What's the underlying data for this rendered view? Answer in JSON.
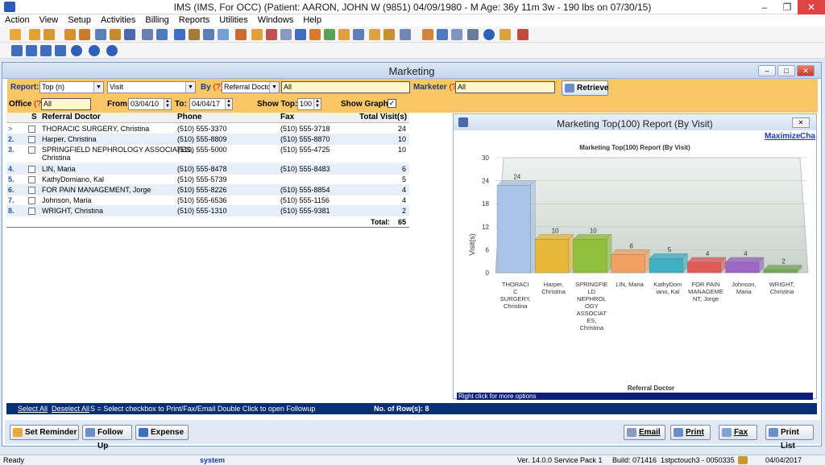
{
  "window": {
    "title": "IMS (IMS, For OCC)    (Patient: AARON, JOHN W (9851) 04/09/1980 - M Age: 36y 11m 3w - 190 lbs on 07/30/15)"
  },
  "menu": [
    "Action",
    "View",
    "Setup",
    "Activities",
    "Billing",
    "Reports",
    "Utilities",
    "Windows",
    "Help"
  ],
  "marketing": {
    "title": "Marketing",
    "filters": {
      "report_label": "Report:",
      "report_value": "Top (n)",
      "report_type": "Visit",
      "by_label": "By",
      "by_value": "Referral Doctor",
      "by_filter": "All",
      "marketer_label": "Marketer",
      "marketer_value": "All",
      "retrieve_label": "Retrieve",
      "office_label": "Office",
      "office_value": "All",
      "from_label": "From:",
      "from_value": "03/04/10",
      "to_label": "To:",
      "to_value": "04/04/17",
      "show_top_label": "Show Top:",
      "show_top_value": "100",
      "show_graph_label": "Show Graph:",
      "q": "(?)"
    },
    "table": {
      "headers": [
        "S",
        "Referral Doctor",
        "Phone",
        "Fax",
        "Total Visit(s)"
      ],
      "rows": [
        {
          "num": ">",
          "doctor": "THORACIC SURGERY, Christina",
          "phone": "(510) 555-3370",
          "fax": "(510) 555-3718",
          "visits": "24"
        },
        {
          "num": "2.",
          "doctor": "Harper, Christina",
          "phone": "(510) 555-8809",
          "fax": "(510) 555-8870",
          "visits": "10"
        },
        {
          "num": "3.",
          "doctor": "SPRINGFIELD NEPHROLOGY ASSOCIATES,",
          "doctor2": "Christina",
          "phone": "(510) 555-5000",
          "fax": "(510) 555-4725",
          "visits": "10"
        },
        {
          "num": "4.",
          "doctor": "LIN, Maria",
          "phone": "(510) 555-8478",
          "fax": "(510) 555-8483",
          "visits": "6"
        },
        {
          "num": "5.",
          "doctor": "KathyDomiano, Kal",
          "phone": "(510) 555-5739",
          "fax": "",
          "visits": "5"
        },
        {
          "num": "6.",
          "doctor": "FOR PAIN MANAGEMENT, Jorge",
          "phone": "(510) 555-8226",
          "fax": "(510) 555-8854",
          "visits": "4"
        },
        {
          "num": "7.",
          "doctor": "Johnson, Maria",
          "phone": "(510) 555-6536",
          "fax": "(510) 555-1156",
          "visits": "4"
        },
        {
          "num": "8.",
          "doctor": "WRIGHT, Christina",
          "phone": "(510) 555-1310",
          "fax": "(510) 555-9381",
          "visits": "2"
        }
      ],
      "total_label": "Total:",
      "total_value": "65"
    },
    "chart_panel": {
      "title": "Marketing Top(100) Report (By Visit)",
      "maximize": "Maximize",
      "cha": "Cha",
      "hint": "Right click for more options"
    },
    "footer": {
      "select_all": "Select All",
      "deselect_all": "Deselect All",
      "hint": "S = Select checkbox to Print/Fax/Email  Double Click to open Followup",
      "rows_label": "No. of Row(s): 8"
    },
    "buttons": {
      "set_reminder": "Set Reminder",
      "follow_up": "Follow Up",
      "expense": "Expense",
      "email": "Email",
      "print": "Print",
      "fax": "Fax",
      "print_list": "Print List"
    }
  },
  "chart_data": {
    "type": "bar",
    "title": "Marketing Top(100) Report (By Visit)",
    "xlabel": "Referral Doctor",
    "ylabel": "Visit(s)",
    "ylim": [
      0,
      30
    ],
    "yticks": [
      "30",
      "24",
      "18",
      "12",
      "6",
      "0"
    ],
    "categories": [
      [
        "THORACI",
        "C",
        "SURGERY,",
        "Christina"
      ],
      [
        "Harper,",
        "Christina"
      ],
      [
        "SPRINGFIE",
        "LD",
        "NEPHROL",
        "OGY",
        "ASSOCIAT",
        "ES,",
        "Christina"
      ],
      [
        "LIN, Maria"
      ],
      [
        "KathyDom",
        "iano, Kal"
      ],
      [
        "FOR PAIN",
        "MANAGEME",
        "NT, Jorge"
      ],
      [
        "Johnson,",
        "Maria"
      ],
      [
        "WRIGHT,",
        "Christina"
      ]
    ],
    "values": [
      24,
      10,
      10,
      6,
      5,
      4,
      4,
      2
    ],
    "colors": [
      "#a9c4e6",
      "#e8b83a",
      "#8fbf3c",
      "#f2a062",
      "#3fb0c2",
      "#e05a5a",
      "#9b66c4",
      "#78a858"
    ]
  },
  "status": {
    "ready": "Ready",
    "user": "system",
    "version": "Ver. 14.0.0 Service Pack 1",
    "build": "Build: 071416",
    "server": "1stpctouch3 - 0050335",
    "date": "04/04/2017"
  }
}
